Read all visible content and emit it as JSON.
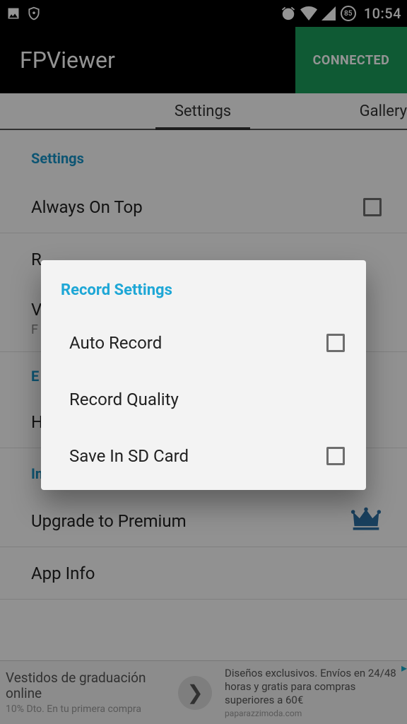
{
  "status": {
    "time": "10:54",
    "battery": "85"
  },
  "app": {
    "title": "FPViewer",
    "status_label": "CONNECTED"
  },
  "tabs": {
    "settings": "Settings",
    "gallery": "Gallery"
  },
  "settings": {
    "section_label": "Settings",
    "items": [
      {
        "label": "Always On Top"
      },
      {
        "label": "V",
        "sub": "F"
      },
      {
        "label": "E"
      },
      {
        "label": "H"
      }
    ],
    "record_row_partial": "R"
  },
  "info": {
    "section_label": "Info",
    "upgrade": "Upgrade to Premium",
    "app_info": "App Info"
  },
  "dialog": {
    "title": "Record Settings",
    "items": [
      {
        "label": "Auto Record",
        "checkbox": true
      },
      {
        "label": "Record Quality",
        "checkbox": false
      },
      {
        "label": "Save In SD Card",
        "checkbox": true
      }
    ]
  },
  "ad": {
    "left_line1": "Vestidos de graduación online",
    "left_line2": "10% Dto. En tu primera compra",
    "right_line1": "Diseños exclusivos. Envíos en 24/48 horas y gratis para compras superiores a 60€",
    "right_line2": "paparazzimoda.com"
  }
}
